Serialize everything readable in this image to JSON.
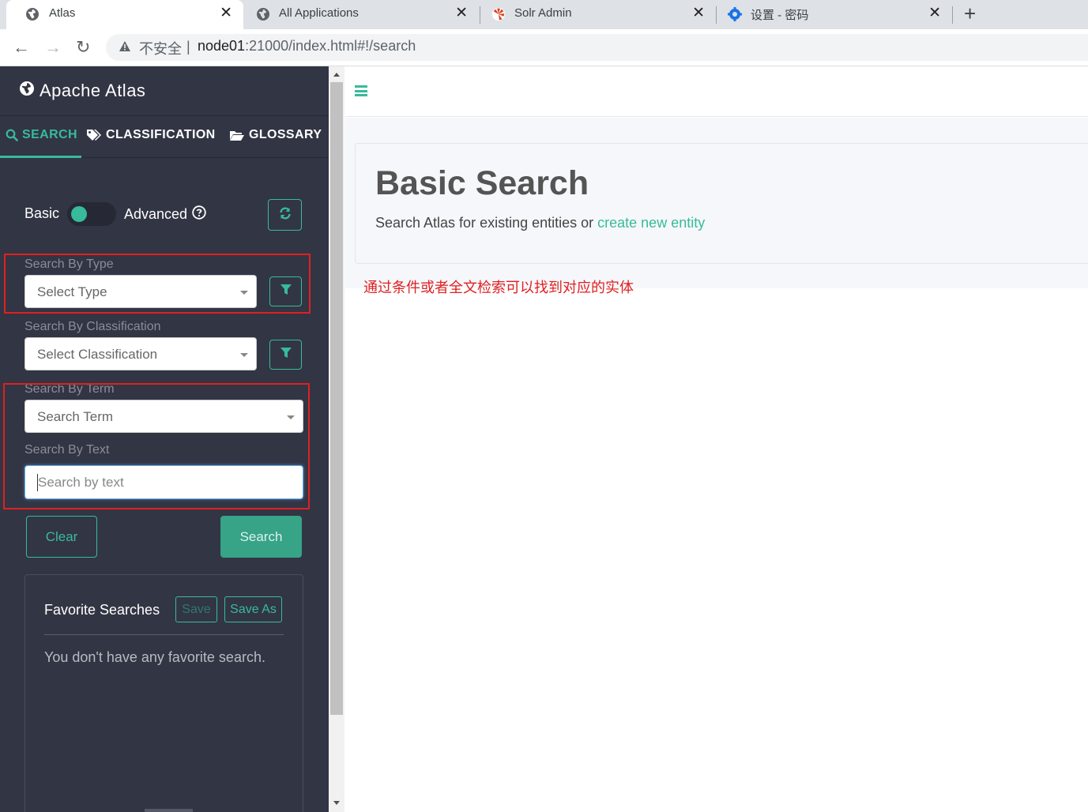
{
  "browser": {
    "tabs": [
      {
        "title": "Atlas",
        "active": true
      },
      {
        "title": "All Applications",
        "active": false
      },
      {
        "title": "Solr Admin",
        "active": false
      },
      {
        "title": "设置 - 密码",
        "active": false
      }
    ],
    "close_glyph": "✕",
    "new_tab_glyph": "+",
    "back_glyph": "←",
    "forward_glyph": "→",
    "reload_glyph": "↻",
    "address": {
      "insecure_label": "不安全",
      "divider": "|",
      "host": "node01",
      "path": ":21000/index.html#!/search"
    }
  },
  "sidebar": {
    "brand": "Apache Atlas",
    "tabs": [
      {
        "label": "SEARCH",
        "icon": "search-icon"
      },
      {
        "label": "CLASSIFICATION",
        "icon": "tags-icon"
      },
      {
        "label": "GLOSSARY",
        "icon": "folder-open-icon"
      }
    ],
    "toggle": {
      "basic": "Basic",
      "advanced": "Advanced"
    },
    "type": {
      "label": "Search By Type",
      "placeholder": "Select Type"
    },
    "classification": {
      "label": "Search By Classification",
      "placeholder": "Select Classification"
    },
    "term": {
      "label": "Search By Term",
      "placeholder": "Search Term"
    },
    "text": {
      "label": "Search By Text",
      "placeholder": "Search by text"
    },
    "clear_label": "Clear",
    "search_label": "Search",
    "favorites": {
      "title": "Favorite Searches",
      "save": "Save",
      "save_as": "Save As",
      "empty": "You don't have any favorite search."
    }
  },
  "main": {
    "title": "Basic Search",
    "subtitle_prefix": "Search Atlas for existing entities or ",
    "subtitle_link": "create new entity",
    "annotation": "通过条件或者全文检索可以找到对应的实体"
  },
  "colors": {
    "accent": "#37bb9b",
    "sidebar_bg": "#323544",
    "annotation_red": "#e02020"
  }
}
